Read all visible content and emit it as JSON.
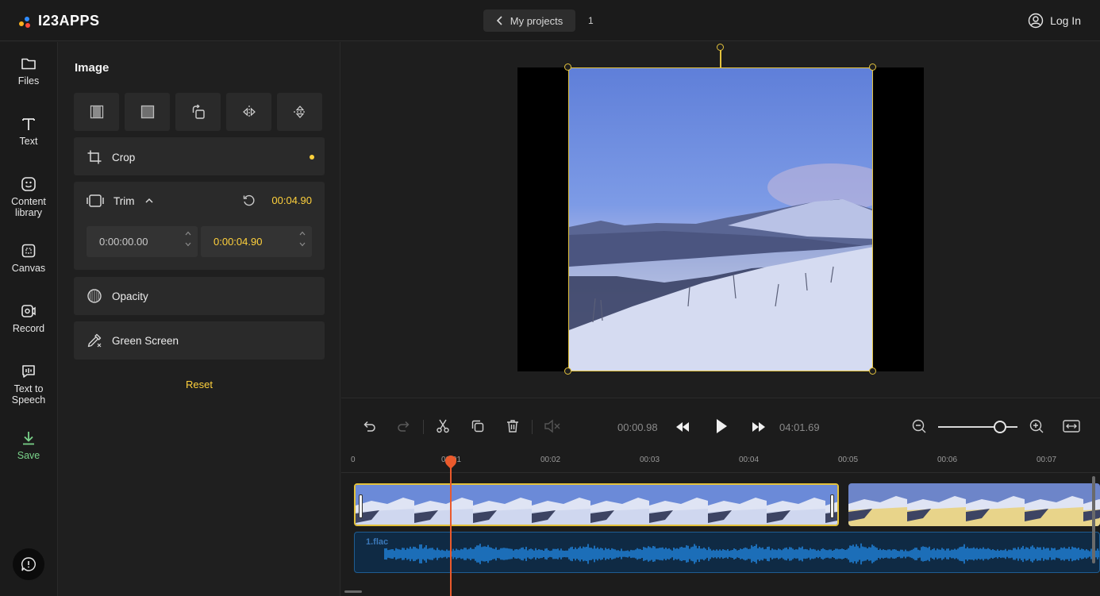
{
  "app": {
    "logo_text": "I23APPS"
  },
  "header": {
    "my_projects_label": "My projects",
    "project_count": "1",
    "login_label": "Log In"
  },
  "leftnav": {
    "items": [
      {
        "label": "Files",
        "icon": "folder-icon"
      },
      {
        "label": "Text",
        "icon": "text-icon"
      },
      {
        "label": "Content library",
        "icon": "sticker-icon"
      },
      {
        "label": "Canvas",
        "icon": "canvas-icon"
      },
      {
        "label": "Record",
        "icon": "record-icon"
      },
      {
        "label": "Text to Speech",
        "icon": "speech-icon"
      },
      {
        "label": "Save",
        "icon": "download-icon"
      }
    ]
  },
  "panel": {
    "title": "Image",
    "tools": [
      "fill-icon",
      "fit-icon",
      "rotate-icon",
      "flip-horizontal-icon",
      "flip-vertical-icon"
    ],
    "crop_label": "Crop",
    "trim_label": "Trim",
    "trim_duration": "00:04.90",
    "trim_start": "0:00:00.00",
    "trim_end": "0:00:04.90",
    "opacity_label": "Opacity",
    "green_screen_label": "Green Screen",
    "reset_label": "Reset"
  },
  "timeline": {
    "current_time": "00:00.98",
    "total_time": "04:01.69",
    "zoom_level": 0.78,
    "ticks": [
      "0",
      "00:01",
      "00:02",
      "00:03",
      "00:04",
      "00:05",
      "00:06",
      "00:07"
    ],
    "audio_track_label": "1.flac"
  },
  "colors": {
    "accent": "#ffd13c",
    "selection": "#e3c23c",
    "playhead": "#ea5a2c",
    "save": "#7ad38a",
    "audio": "#1f7fd6"
  }
}
